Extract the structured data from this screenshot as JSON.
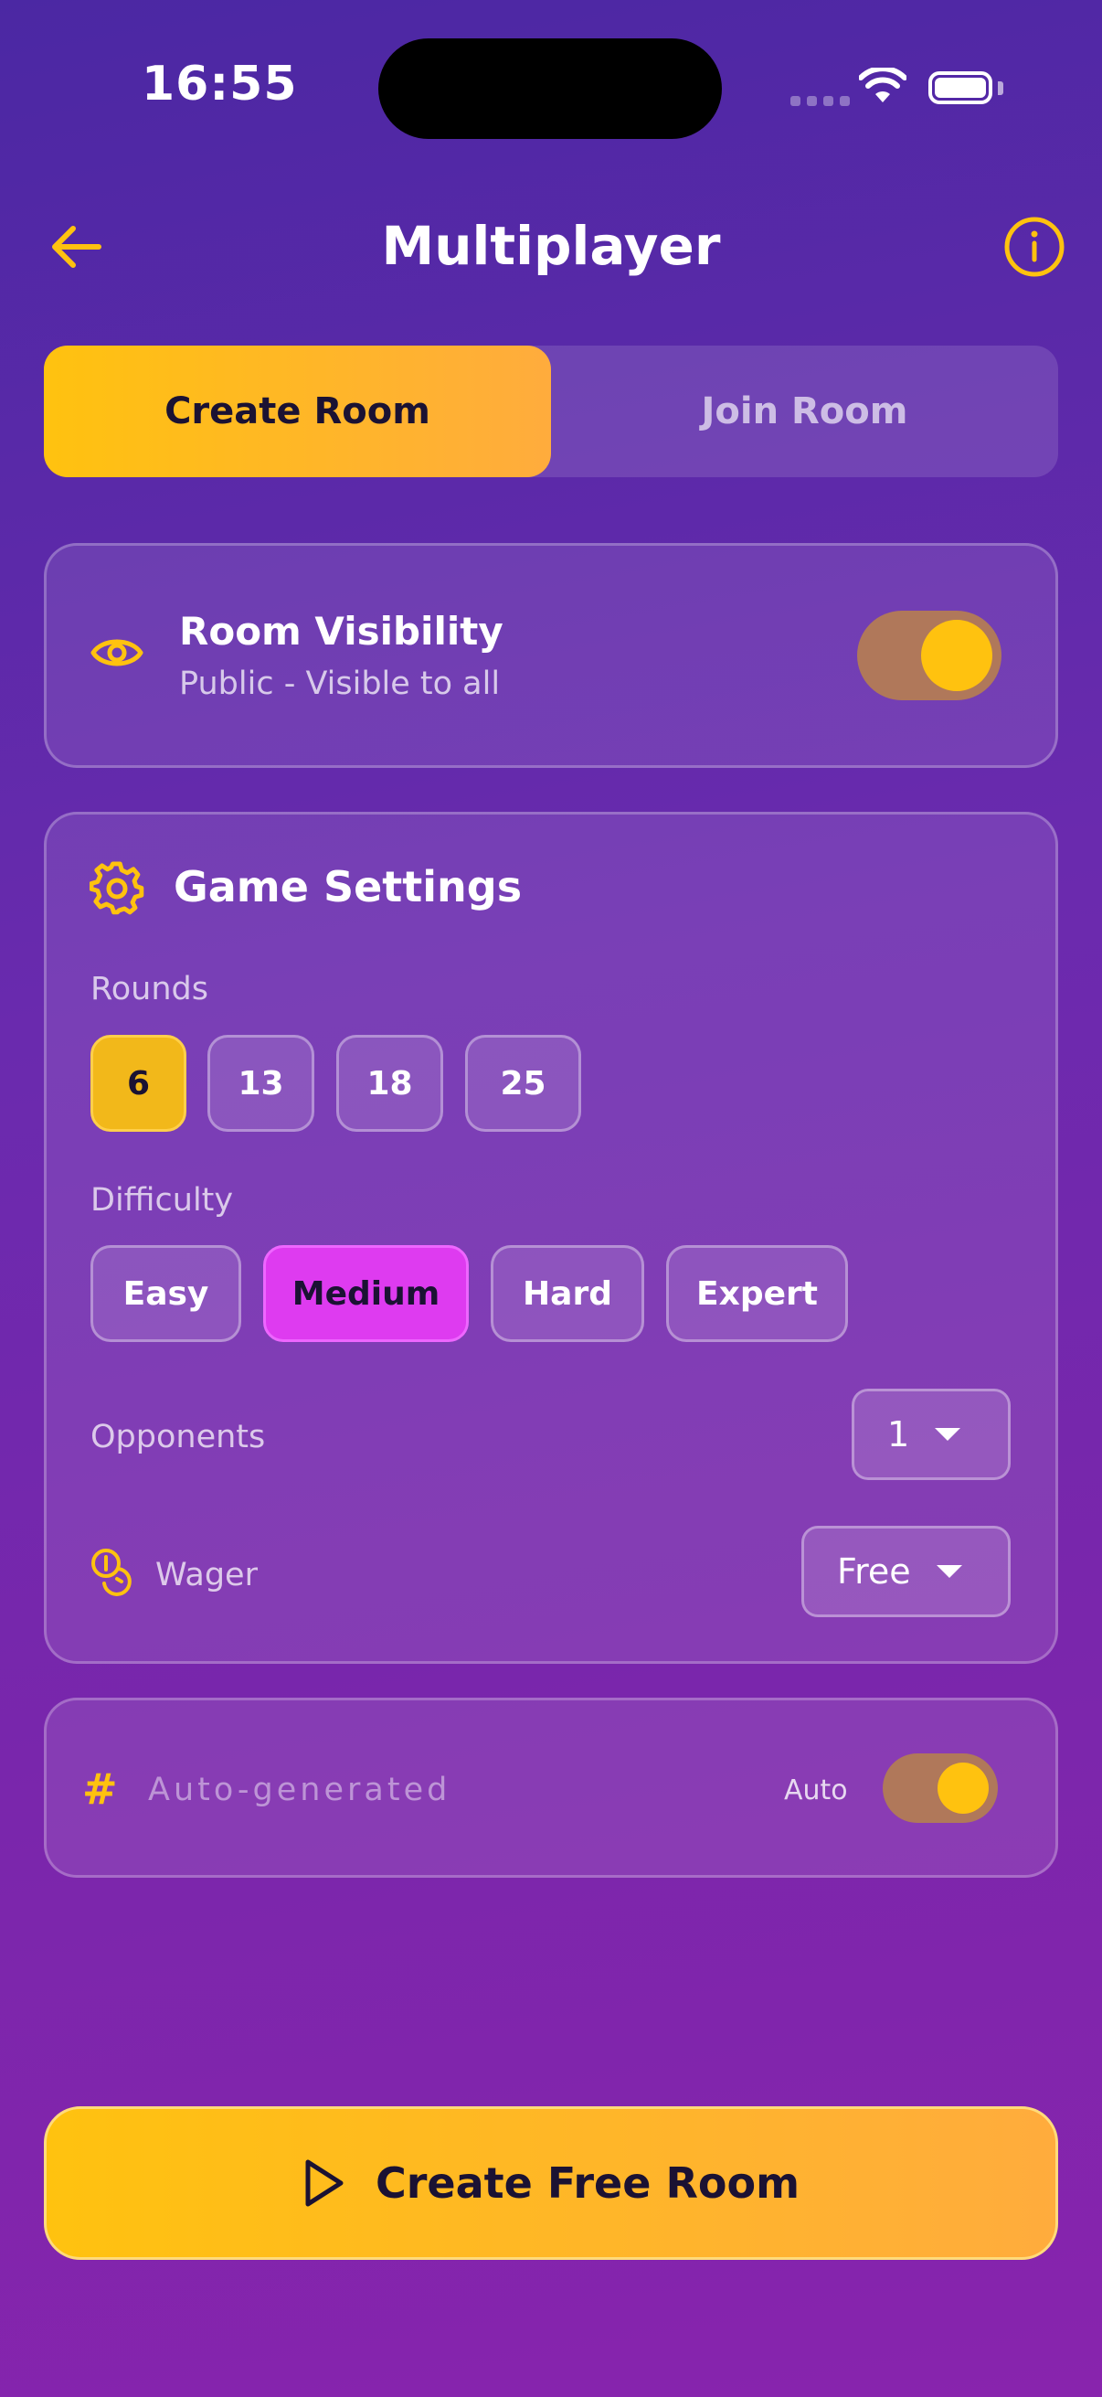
{
  "status_bar": {
    "time": "16:55"
  },
  "header": {
    "title": "Multiplayer",
    "back_icon": "arrow-left-icon",
    "info_icon": "info-circle-icon"
  },
  "tabs": [
    {
      "label": "Create Room",
      "selected": true
    },
    {
      "label": "Join Room",
      "selected": false
    }
  ],
  "visibility": {
    "icon": "eye-icon",
    "title": "Room Visibility",
    "subtitle": "Public - Visible to all",
    "toggle_on": true
  },
  "settings": {
    "icon": "gear-icon",
    "title": "Game Settings",
    "rounds_label": "Rounds",
    "rounds": [
      "6",
      "13",
      "18",
      "25"
    ],
    "rounds_selected": "6",
    "difficulty_label": "Difficulty",
    "difficulties": [
      "Easy",
      "Medium",
      "Hard",
      "Expert"
    ],
    "difficulty_selected": "Medium",
    "opponents_label": "Opponents",
    "opponents_value": "1",
    "wager_label": "Wager",
    "wager_value": "Free"
  },
  "room_code": {
    "icon": "hash-icon",
    "placeholder": "Auto-generated",
    "auto_label": "Auto",
    "auto_on": true
  },
  "cta": {
    "label": "Create Free Room",
    "icon": "play-icon"
  },
  "colors": {
    "accent_gold": "#ffc20f",
    "accent_pink": "#de3bf0",
    "background_top": "#4b28a3",
    "background_bottom": "#8824ad"
  }
}
